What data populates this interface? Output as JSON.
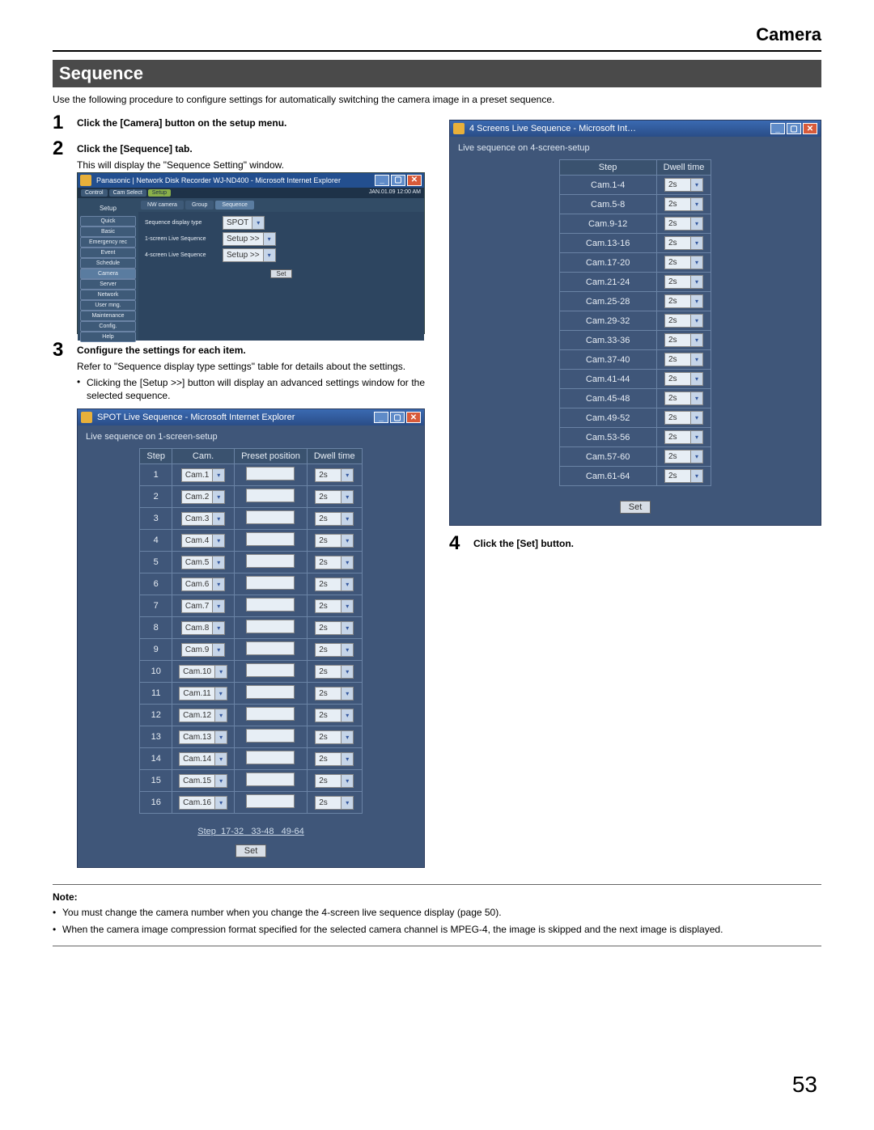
{
  "page_title": "Camera",
  "section_title": "Sequence",
  "intro": "Use the following procedure to configure settings for automatically switching the camera image in a preset sequence.",
  "steps": {
    "s1_num": "1",
    "s1_bold": "Click the [Camera] button on the setup menu.",
    "s2_num": "2",
    "s2_bold": "Click the [Sequence] tab.",
    "s2_p": "This will display the \"Sequence Setting\" window.",
    "s3_num": "3",
    "s3_bold": "Configure the settings for each item.",
    "s3_p1": "Refer to \"Sequence display type settings\" table for details about the settings.",
    "s3_b1": "Clicking the [Setup >>] button will display an advanced settings window for the selected sequence.",
    "s4_num": "4",
    "s4_bold": "Click the [Set] button."
  },
  "mainwin": {
    "title": "Panasonic | Network Disk Recorder WJ-ND400 - Microsoft Internet Explorer",
    "time": "JAN.01.09 12:00 AM",
    "top_tabs": [
      "Control",
      "Cam Select",
      "Setup"
    ],
    "side_header": "Setup",
    "side_items": [
      "Quick",
      "Basic",
      "Emergency rec",
      "Event",
      "Schedule",
      "Camera",
      "Server",
      "Network",
      "User mng.",
      "Maintenance",
      "Config.",
      "Help"
    ],
    "tabs": [
      "NW camera",
      "Group",
      "Sequence"
    ],
    "rows": [
      [
        "Sequence display type",
        "SPOT"
      ],
      [
        "1-screen Live Sequence",
        "Setup >>"
      ],
      [
        "4-screen Live Sequence",
        "Setup >>"
      ]
    ],
    "set": "Set"
  },
  "spotwin": {
    "title": "SPOT Live Sequence - Microsoft Internet Explorer",
    "subtitle": "Live sequence on 1-screen-setup",
    "headers": [
      "Step",
      "Cam.",
      "Preset position",
      "Dwell time"
    ],
    "cams": [
      "Cam.1",
      "Cam.2",
      "Cam.3",
      "Cam.4",
      "Cam.5",
      "Cam.6",
      "Cam.7",
      "Cam.8",
      "Cam.9",
      "Cam.10",
      "Cam.11",
      "Cam.12",
      "Cam.13",
      "Cam.14",
      "Cam.15",
      "Cam.16"
    ],
    "dwell": "2s",
    "pager_label": "Step",
    "pager": [
      "17-32",
      "33-48",
      "49-64"
    ],
    "set": "Set"
  },
  "fourwin": {
    "title": "4 Screens Live Sequence - Microsoft Int…",
    "subtitle": "Live sequence on 4-screen-setup",
    "headers": [
      "Step",
      "Dwell time"
    ],
    "steps": [
      "Cam.1-4",
      "Cam.5-8",
      "Cam.9-12",
      "Cam.13-16",
      "Cam.17-20",
      "Cam.21-24",
      "Cam.25-28",
      "Cam.29-32",
      "Cam.33-36",
      "Cam.37-40",
      "Cam.41-44",
      "Cam.45-48",
      "Cam.49-52",
      "Cam.53-56",
      "Cam.57-60",
      "Cam.61-64"
    ],
    "dwell": "2s",
    "set": "Set"
  },
  "note_title": "Note:",
  "notes": [
    "You must change the camera number when you change the 4-screen live sequence display (page 50).",
    "When the camera image compression format specified for the selected camera channel is MPEG-4, the image is skipped and the next image is displayed."
  ],
  "page_number": "53",
  "icons": {
    "min": "_",
    "max": "▢",
    "close": "✕",
    "arrow": "▾"
  }
}
